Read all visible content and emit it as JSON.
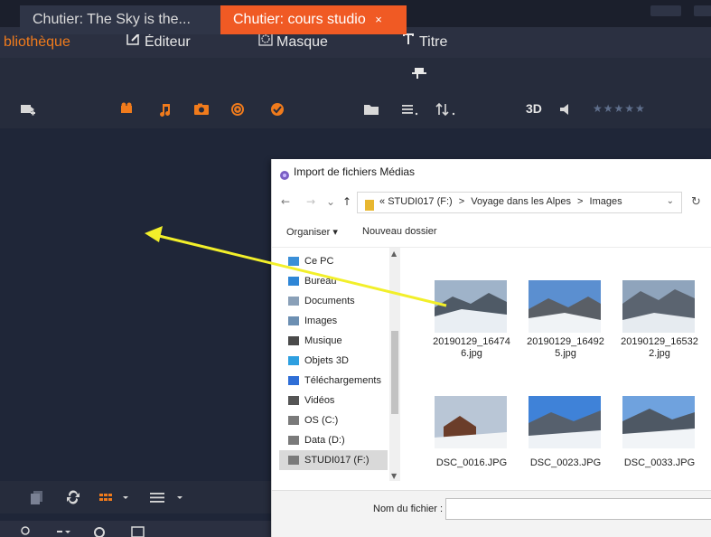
{
  "main_tabs": [
    {
      "label": "bliothèque",
      "icon": "library-icon",
      "active": true
    },
    {
      "label": "Éditeur",
      "icon": "edit-icon",
      "active": false
    },
    {
      "label": "Masque",
      "icon": "mask-icon",
      "active": false
    },
    {
      "label": "Titre",
      "icon": "title-icon",
      "active": false
    }
  ],
  "sub_tabs": [
    {
      "label": "Chutier: The Sky is the...",
      "active": false
    },
    {
      "label": "Chutier: cours studio",
      "close": "×",
      "active": true
    }
  ],
  "toolbar": {
    "view_3d": "3D",
    "rating": "★★★★★",
    "icons": [
      "add-media-icon",
      "video-icon",
      "music-icon",
      "photo-icon",
      "project-icon",
      "check-icon",
      "folder-icon",
      "list-sort-icon",
      "sort-icon",
      "speaker-icon"
    ]
  },
  "dialog": {
    "title": "Import de fichiers Médias",
    "address": {
      "drive": "STUDI017 (F:)",
      "folder": "Voyage dans les Alpes",
      "subfolder": "Images",
      "sep": ">",
      "prefix": "«"
    },
    "nav_back": "←",
    "nav_forward": "→",
    "nav_recent": "⌄",
    "nav_up": "↑",
    "refresh": "↻",
    "chevron": "⌄",
    "commands": {
      "organize": "Organiser ▾",
      "new_folder": "Nouveau dossier"
    },
    "nav_items": [
      {
        "label": "Ce PC",
        "icon": "pc-icon",
        "color": "#3b8fd8"
      },
      {
        "label": "Bureau",
        "icon": "desktop-icon",
        "color": "#2f86d6"
      },
      {
        "label": "Documents",
        "icon": "documents-icon",
        "color": "#8aa0b8"
      },
      {
        "label": "Images",
        "icon": "images-icon",
        "color": "#6c8fb2"
      },
      {
        "label": "Musique",
        "icon": "music-icon",
        "color": "#4a4a4a"
      },
      {
        "label": "Objets 3D",
        "icon": "objects3d-icon",
        "color": "#2e9fe0"
      },
      {
        "label": "Téléchargements",
        "icon": "downloads-icon",
        "color": "#2f6ed6"
      },
      {
        "label": "Vidéos",
        "icon": "videos-icon",
        "color": "#555555"
      },
      {
        "label": "OS (C:)",
        "icon": "drive-icon",
        "color": "#7a7a7a"
      },
      {
        "label": "Data (D:)",
        "icon": "drive-icon",
        "color": "#7a7a7a"
      },
      {
        "label": "STUDI017 (F:)",
        "icon": "usb-drive-icon",
        "color": "#7a7a7a",
        "selected": true
      }
    ],
    "files_row1": [
      {
        "name": "20190129_164746.jpg",
        "line1": "20190129_16474",
        "line2": "6.jpg"
      },
      {
        "name": "20190129_164925.jpg",
        "line1": "20190129_16492",
        "line2": "5.jpg"
      },
      {
        "name": "20190129_165322.jpg",
        "line1": "20190129_16532",
        "line2": "2.jpg"
      }
    ],
    "files_row2": [
      {
        "name": "DSC_0016.JPG"
      },
      {
        "name": "DSC_0023.JPG"
      },
      {
        "name": "DSC_0033.JPG"
      }
    ],
    "filename_label": "Nom du fichier :",
    "filename_value": ""
  },
  "colors": {
    "accent": "#f07b1c",
    "active_tab": "#f05a24",
    "arrow": "#f2ef2a",
    "app_bg": "#1f2638"
  }
}
